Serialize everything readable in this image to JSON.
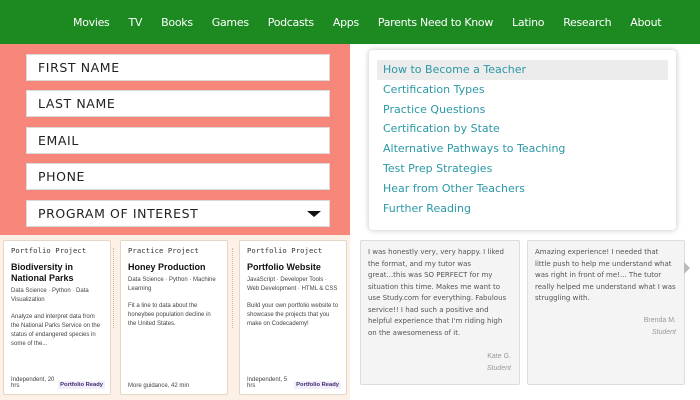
{
  "nav": {
    "items": [
      {
        "label": "Movies"
      },
      {
        "label": "TV"
      },
      {
        "label": "Books"
      },
      {
        "label": "Games"
      },
      {
        "label": "Podcasts"
      },
      {
        "label": "Apps"
      },
      {
        "label": "Parents Need to Know"
      },
      {
        "label": "Latino"
      },
      {
        "label": "Research"
      },
      {
        "label": "About"
      }
    ]
  },
  "form": {
    "first_name": "FIRST NAME",
    "last_name": "LAST NAME",
    "email": "EMAIL",
    "phone": "PHONE",
    "program": "PROGRAM OF INTEREST"
  },
  "links": [
    {
      "label": "How to Become a Teacher"
    },
    {
      "label": "Certification Types"
    },
    {
      "label": "Practice Questions"
    },
    {
      "label": "Certification by State"
    },
    {
      "label": "Alternative Pathways to Teaching"
    },
    {
      "label": "Test Prep Strategies"
    },
    {
      "label": "Hear from Other Teachers"
    },
    {
      "label": "Further Reading"
    }
  ],
  "projects": [
    {
      "type": "Portfolio Project",
      "title": "Biodiversity in National Parks",
      "tags": "Data Science · Python · Data Visualization",
      "desc": "Analyze and interpret data from the National Parks Service on the status of endangered species in some of the...",
      "meta": "Independent, 20 hrs",
      "badge": "Portfolio Ready"
    },
    {
      "type": "Practice Project",
      "title": "Honey Production",
      "tags": "Data Science · Python · Machine Learning",
      "desc": "Fit a line to data about the honeybee population decline in the United States.",
      "meta": "More guidance, 42 min",
      "badge": ""
    },
    {
      "type": "Portfolio Project",
      "title": "Portfolio Website",
      "tags": "JavaScript · Developer Tools · Web Development · HTML & CSS",
      "desc": "Build your own portfolio website to showcase the projects that you make on Codecademy!",
      "meta": "Independent, 5 hrs",
      "badge": "Portfolio Ready"
    }
  ],
  "testimonials": [
    {
      "text": "I was honestly very, very happy. I liked the format, and my tutor was great...this was SO PERFECT for my situation this time. Makes me want to use Study.com for everything. Fabulous service!! I had such a positive and helpful experience that I'm riding high on the awesomeness of it.",
      "name": "Kate G.",
      "role": "Student"
    },
    {
      "text": "Amazing experience! I needed that little push to help me understand what was right in front of me!... The tutor really helped me understand what I was struggling with.",
      "name": "Brenda M.",
      "role": "Student"
    }
  ],
  "colors": {
    "nav_bg": "#1c8a21",
    "form_bg": "#f7877a",
    "link": "#2b98a6"
  }
}
